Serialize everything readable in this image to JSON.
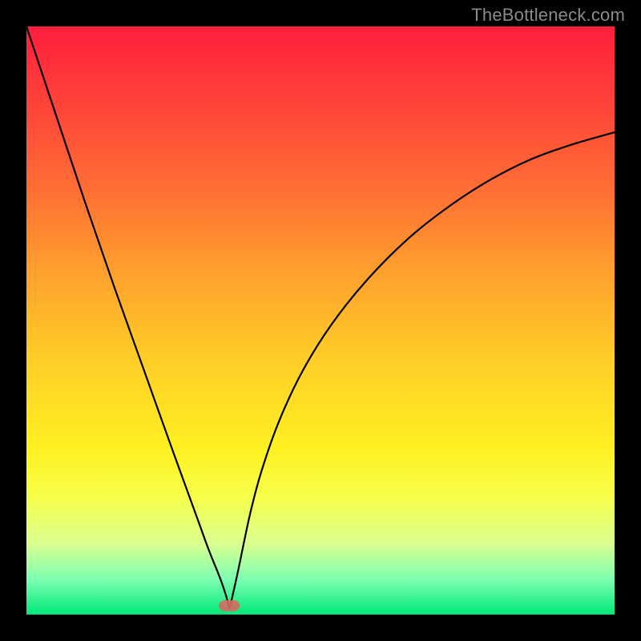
{
  "watermark": "TheBottleneck.com",
  "frame": {
    "outer_w": 800,
    "outer_h": 800,
    "inner_x": 33,
    "inner_y": 33,
    "inner_w": 734,
    "inner_h": 734,
    "border_color": "#000000"
  },
  "gradient_stops": [
    {
      "pos": 0,
      "color": "#ff1e3c"
    },
    {
      "pos": 10,
      "color": "#ff3a3a"
    },
    {
      "pos": 28,
      "color": "#ff6f34"
    },
    {
      "pos": 40,
      "color": "#ff9a2e"
    },
    {
      "pos": 55,
      "color": "#ffc928"
    },
    {
      "pos": 72,
      "color": "#fff122"
    },
    {
      "pos": 80,
      "color": "#f7ff4a"
    },
    {
      "pos": 88,
      "color": "#d9ff90"
    },
    {
      "pos": 94,
      "color": "#7dffb0"
    },
    {
      "pos": 100,
      "color": "#00e87a"
    }
  ],
  "marker": {
    "color": "#d66a5e",
    "x_frac": 0.345,
    "y_frac": 0.985
  },
  "chart_data": {
    "type": "line",
    "title": "",
    "xlabel": "",
    "ylabel": "",
    "xlim": [
      0,
      1
    ],
    "ylim": [
      0,
      1
    ],
    "notes": "Axes are unlabeled in the source image; x and y are normalized 0..1 within the plot area. y=0 is the bottom (green) edge. The curve is a V-shape touching near y≈0 at x≈0.345, with a steep nearly-linear left branch rising to the top-left corner and a concave right branch rising to about y≈0.82 at x=1.",
    "series": [
      {
        "name": "curve",
        "x": [
          0.0,
          0.05,
          0.1,
          0.15,
          0.2,
          0.25,
          0.29,
          0.31,
          0.33,
          0.34,
          0.345,
          0.35,
          0.36,
          0.38,
          0.4,
          0.43,
          0.47,
          0.52,
          0.58,
          0.65,
          0.72,
          0.79,
          0.86,
          0.93,
          1.0
        ],
        "y": [
          1.0,
          0.85,
          0.7,
          0.555,
          0.415,
          0.275,
          0.165,
          0.11,
          0.06,
          0.03,
          0.01,
          0.03,
          0.075,
          0.17,
          0.245,
          0.33,
          0.415,
          0.495,
          0.57,
          0.64,
          0.695,
          0.74,
          0.775,
          0.8,
          0.82
        ]
      }
    ],
    "optimum_marker": {
      "x": 0.345,
      "y": 0.015
    }
  }
}
